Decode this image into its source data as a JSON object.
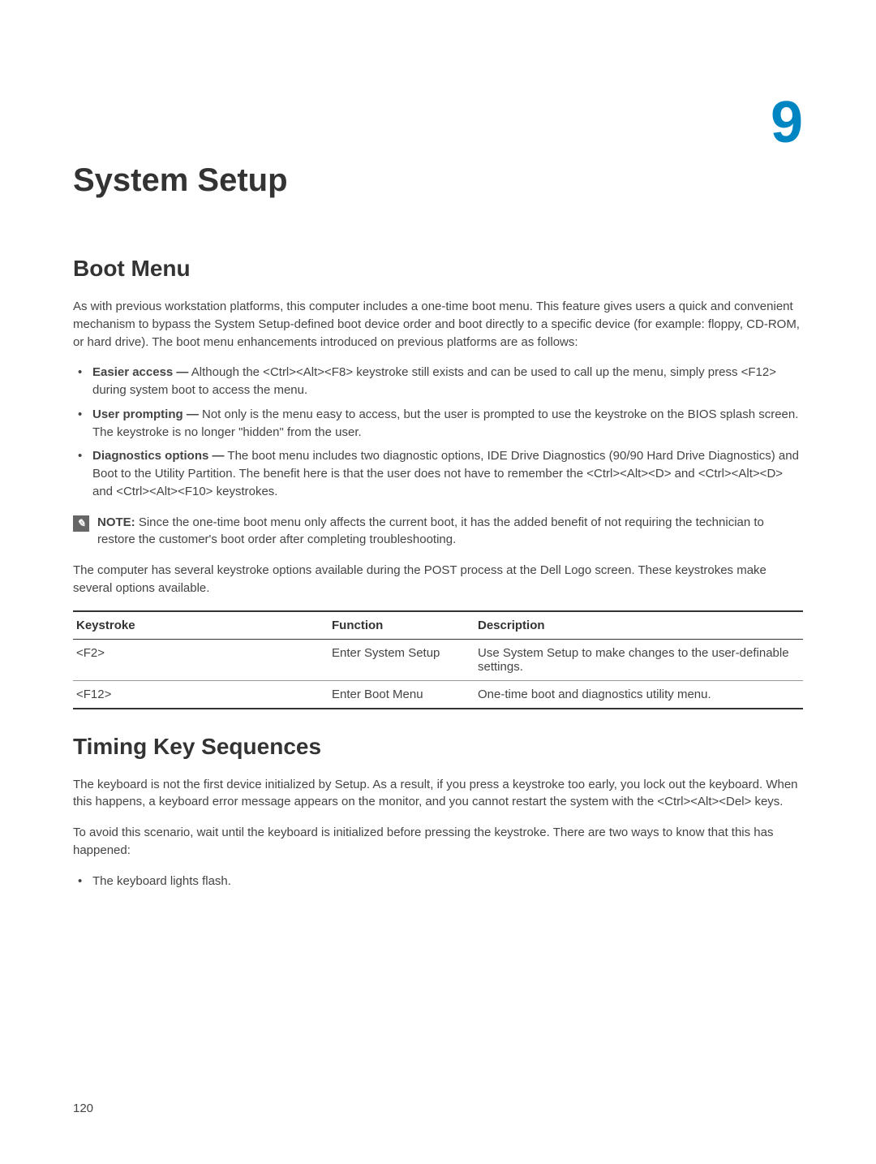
{
  "chapter_num": "9",
  "title": "System Setup",
  "section_boot_menu": {
    "heading": "Boot Menu",
    "intro": "As with previous workstation platforms, this computer includes a one-time boot menu. This feature gives users a quick and convenient mechanism to bypass the System Setup-defined boot device order and boot directly to a specific device (for example: floppy, CD-ROM, or hard drive). The boot menu enhancements introduced on previous platforms are as follows:",
    "bullets": [
      {
        "bold": "Easier access —",
        "rest": " Although the <Ctrl><Alt><F8> keystroke still exists and can be used to call up the menu, simply press <F12> during system boot to access the menu."
      },
      {
        "bold": "User prompting —",
        "rest": " Not only is the menu easy to access, but the user is prompted to use the keystroke on the BIOS splash screen. The keystroke is no longer \"hidden\" from the user."
      },
      {
        "bold": "Diagnostics options —",
        "rest": " The boot menu includes two diagnostic options, IDE Drive Diagnostics (90/90 Hard Drive Diagnostics) and Boot to the Utility Partition. The benefit here is that the user does not have to remember the <Ctrl><Alt><D> and <Ctrl><Alt><D> and <Ctrl><Alt><F10> keystrokes."
      }
    ],
    "note": {
      "label": "NOTE:",
      "text": " Since the one-time boot menu only affects the current boot, it has the added benefit of not requiring the technician to restore the customer's boot order after completing troubleshooting."
    },
    "table_intro": "The computer has several keystroke options available during the POST process at the Dell Logo screen. These keystrokes make several options available.",
    "table": {
      "headers": [
        "Keystroke",
        "Function",
        "Description"
      ],
      "rows": [
        {
          "keystroke": "<F2>",
          "function": "Enter System Setup",
          "description": "Use System Setup to make changes to the user-definable settings."
        },
        {
          "keystroke": "<F12>",
          "function": "Enter Boot Menu",
          "description": "One-time boot and diagnostics utility menu."
        }
      ]
    }
  },
  "section_timing": {
    "heading": "Timing Key Sequences",
    "p1": "The keyboard is not the first device initialized by Setup. As a result, if you press a keystroke too early, you lock out the keyboard. When this happens, a keyboard error message appears on the monitor, and you cannot restart the system with the <Ctrl><Alt><Del> keys.",
    "p2": "To avoid this scenario, wait until the keyboard is initialized before pressing the keystroke. There are two ways to know that this has happened:",
    "bullet": "The keyboard lights flash."
  },
  "page_num": "120"
}
